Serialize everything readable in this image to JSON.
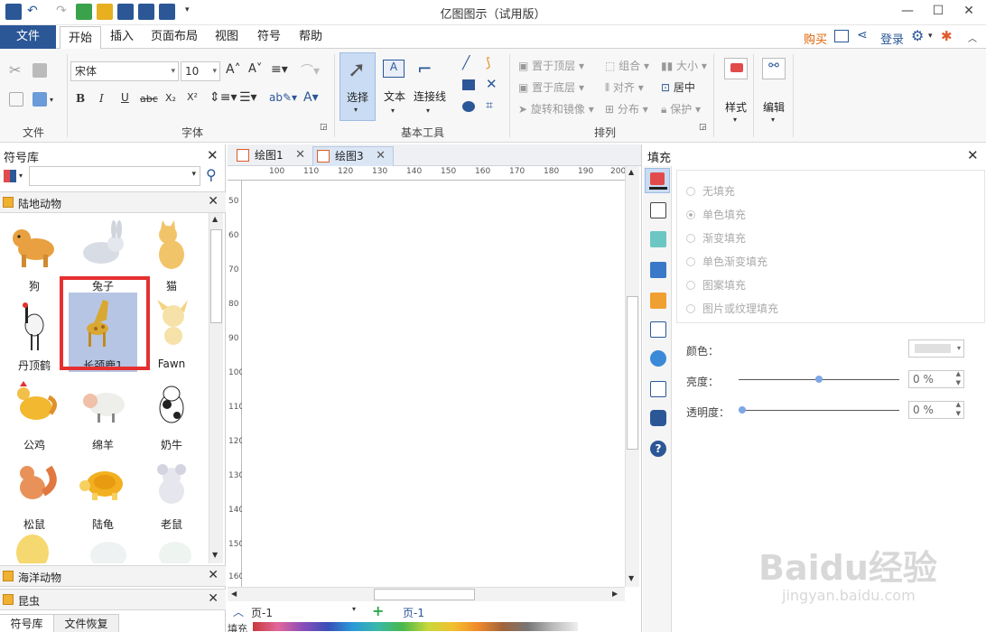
{
  "window": {
    "title": "亿图图示（试用版）",
    "controls": {
      "minimize": "—",
      "maximize": "☐",
      "close": "✕"
    }
  },
  "menu": {
    "file": "文件",
    "tabs": [
      "开始",
      "插入",
      "页面布局",
      "视图",
      "符号",
      "帮助"
    ],
    "active_tab": "开始",
    "buy": "购买",
    "login": "登录"
  },
  "ribbon": {
    "groups": [
      "文件",
      "字体",
      "基本工具",
      "排列"
    ],
    "font_family": "宋体",
    "font_size": "10",
    "tools": {
      "select": "选择",
      "text": "文本",
      "connector": "连接线"
    },
    "arrange": {
      "bring_front": "置于顶层",
      "send_back": "置于底层",
      "rotate": "旋转和镜像",
      "group": "组合",
      "align": "对齐",
      "distribute": "分布",
      "size": "大小",
      "center": "居中",
      "protect": "保护"
    },
    "style": "样式",
    "edit": "编辑"
  },
  "left_panel": {
    "title": "符号库",
    "search_placeholder": "",
    "categories": [
      {
        "name": "陆地动物"
      },
      {
        "name": "海洋动物"
      },
      {
        "name": "昆虫"
      }
    ],
    "symbols": [
      {
        "label": "狗"
      },
      {
        "label": "兔子"
      },
      {
        "label": "猫"
      },
      {
        "label": "丹顶鹤"
      },
      {
        "label": "长颈鹿1"
      },
      {
        "label": "Fawn"
      },
      {
        "label": "公鸡"
      },
      {
        "label": "绵羊"
      },
      {
        "label": "奶牛"
      },
      {
        "label": "松鼠"
      },
      {
        "label": "陆龟"
      },
      {
        "label": "老鼠"
      }
    ],
    "bottom_tabs": [
      "符号库",
      "文件恢复"
    ]
  },
  "document": {
    "tabs": [
      {
        "label": "绘图1"
      },
      {
        "label": "绘图3"
      }
    ],
    "active_tab": "绘图3",
    "hruler": [
      "100",
      "110",
      "120",
      "130",
      "140",
      "150",
      "160",
      "170",
      "180",
      "190",
      "200"
    ],
    "vruler": [
      "50",
      "60",
      "70",
      "80",
      "90",
      "100",
      "110",
      "120",
      "130",
      "140",
      "150",
      "160"
    ],
    "page_selector": "页-1",
    "page_tab": "页-1",
    "fill_label": "填充"
  },
  "right_panel": {
    "title": "填充",
    "fill_options": [
      "无填充",
      "单色填充",
      "渐变填充",
      "单色渐变填充",
      "图案填充",
      "图片或纹理填充"
    ],
    "selected_option": "单色填充",
    "color_label": "颜色：",
    "brightness_label": "亮度：",
    "brightness_value": "0 %",
    "transparency_label": "透明度：",
    "transparency_value": "0 %"
  },
  "watermark": {
    "brand": "Baidu经验",
    "url": "jingyan.baidu.com"
  }
}
